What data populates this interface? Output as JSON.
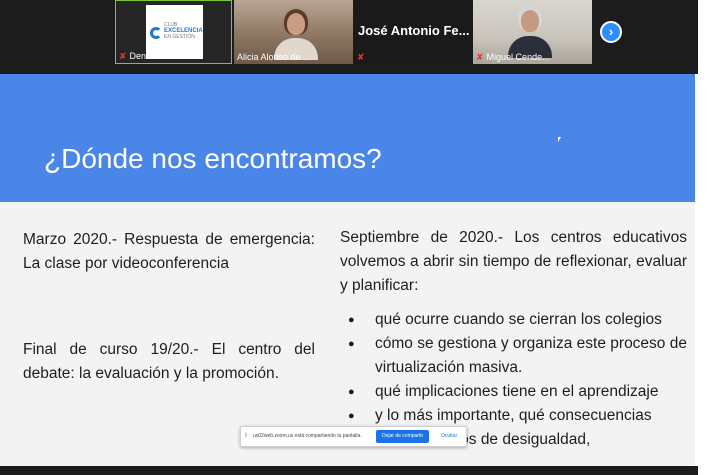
{
  "participants": [
    {
      "name": "Denise - Club ...",
      "muted": true,
      "kind": "logo"
    },
    {
      "name": "Alicia Alonso de ...",
      "muted": false,
      "kind": "video"
    },
    {
      "name": "José Antonio Fe...",
      "muted": true,
      "kind": "name"
    },
    {
      "name": "Miguel Cende...",
      "muted": true,
      "kind": "video"
    }
  ],
  "logo": {
    "line1": "CLUB",
    "line2": "EXCELENCIA",
    "line3": "EN GESTIÓN"
  },
  "next_button_icon": "chevron-right-icon",
  "slide": {
    "title": "¿Dónde nos encontramos?",
    "left": {
      "p1": "Marzo 2020.- Respuesta de emergencia: La clase por videoconferencia",
      "p2": "Final de curso 19/20.- El centro del debate: la evaluación y la promoción."
    },
    "right": {
      "intro": "Septiembre de 2020.- Los centros educativos volvemos a abrir sin tiempo de reflexionar, evaluar y planificar:",
      "bullets": [
        "qué ocurre cuando se cierran los colegios",
        "cómo se gestiona y organiza este proceso de virtualización masiva.",
        "qué implicaciones tiene en el aprendizaje",
        "y lo más importante, qué consecuencias",
        "rminos de desigualdad,"
      ]
    }
  },
  "share_notice": {
    "text": "us02web.zoom.us está compartiendo tu pantalla.",
    "stop_label": "Dejar de compartir",
    "hide_label": "Ocultar"
  },
  "colors": {
    "header_blue": "#4a86e8",
    "active_speaker_border": "#7ec63a",
    "mute_red": "#e03838"
  }
}
